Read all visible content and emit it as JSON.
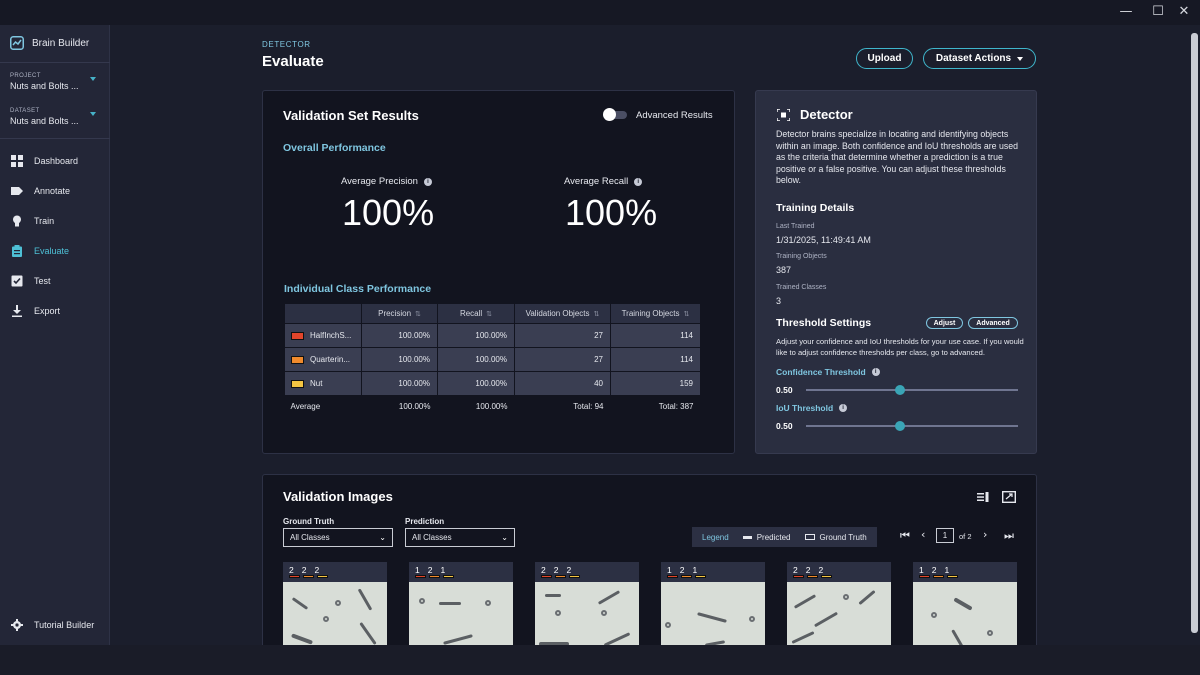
{
  "window": {
    "minimize": "—",
    "maximize": "☐",
    "close": "✕"
  },
  "brand": {
    "name": "Brain Builder",
    "icon": "chart-line-icon"
  },
  "selectors": {
    "project": {
      "caption": "PROJECT",
      "value": "Nuts and Bolts ..."
    },
    "dataset": {
      "caption": "DATASET",
      "value": "Nuts and Bolts ..."
    }
  },
  "nav": [
    {
      "label": "Dashboard",
      "icon": "dashboard-icon"
    },
    {
      "label": "Annotate",
      "icon": "tag-icon"
    },
    {
      "label": "Train",
      "icon": "lightbulb-icon"
    },
    {
      "label": "Evaluate",
      "icon": "clipboard-icon"
    },
    {
      "label": "Test",
      "icon": "checklist-icon"
    },
    {
      "label": "Export",
      "icon": "download-icon"
    }
  ],
  "footer_nav": {
    "label": "Tutorial Builder",
    "icon": "gear-icon"
  },
  "header": {
    "caption": "DETECTOR",
    "title": "Evaluate",
    "upload_label": "Upload",
    "dataset_actions_label": "Dataset Actions"
  },
  "results": {
    "title": "Validation Set Results",
    "advanced_toggle_label": "Advanced Results",
    "overall_title": "Overall Performance",
    "avg_precision_label": "Average Precision",
    "avg_precision_value": "100%",
    "avg_recall_label": "Average Recall",
    "avg_recall_value": "100%",
    "class_title": "Individual Class Performance",
    "columns": [
      "",
      "Precision",
      "Recall",
      "Validation Objects",
      "Training Objects"
    ],
    "rows": [
      {
        "name": "HalfInchS...",
        "color": "#e2452b",
        "precision": "100.00%",
        "recall": "100.00%",
        "validation": "27",
        "training": "114"
      },
      {
        "name": "Quarterin...",
        "color": "#f08a2c",
        "precision": "100.00%",
        "recall": "100.00%",
        "validation": "27",
        "training": "114"
      },
      {
        "name": "Nut",
        "color": "#f4c542",
        "precision": "100.00%",
        "recall": "100.00%",
        "validation": "40",
        "training": "159"
      }
    ],
    "average": {
      "name": "Average",
      "precision": "100.00%",
      "recall": "100.00%",
      "validation": "Total: 94",
      "training": "Total: 387"
    }
  },
  "detector": {
    "title": "Detector",
    "description": "Detector brains specialize in locating and identifying objects within an image. Both confidence and IoU thresholds are used as the criteria that determine whether a prediction is a true positive or a false positive. You can adjust these thresholds below.",
    "training_details_title": "Training Details",
    "last_trained_label": "Last Trained",
    "last_trained_value": "1/31/2025, 11:49:41 AM",
    "training_objects_label": "Training Objects",
    "training_objects_value": "387",
    "trained_classes_label": "Trained Classes",
    "trained_classes_value": "3",
    "threshold_title": "Threshold Settings",
    "adjust_label": "Adjust",
    "advanced_label": "Advanced",
    "threshold_note": "Adjust your confidence and IoU thresholds for your use case. If you would like to adjust confidence thresholds per class, go to advanced.",
    "confidence_label": "Confidence Threshold",
    "confidence_value": "0.50",
    "iou_label": "IoU Threshold",
    "iou_value": "0.50"
  },
  "images": {
    "title": "Validation Images",
    "ground_truth_label": "Ground Truth",
    "ground_truth_value": "All Classes",
    "prediction_label": "Prediction",
    "prediction_value": "All Classes",
    "legend_title": "Legend",
    "legend_predicted": "Predicted",
    "legend_ground_truth": "Ground Truth",
    "page_current": "1",
    "page_of": "of 2",
    "thumbs": [
      {
        "counts": [
          "2",
          "2",
          "2"
        ]
      },
      {
        "counts": [
          "1",
          "2",
          "1"
        ]
      },
      {
        "counts": [
          "2",
          "2",
          "2"
        ]
      },
      {
        "counts": [
          "1",
          "2",
          "1"
        ]
      },
      {
        "counts": [
          "2",
          "2",
          "2"
        ]
      },
      {
        "counts": [
          "1",
          "2",
          "1"
        ]
      }
    ]
  },
  "colors": {
    "accent": "#46b2c8",
    "class_1": "#e2452b",
    "class_2": "#f08a2c",
    "class_3": "#f4c542"
  }
}
